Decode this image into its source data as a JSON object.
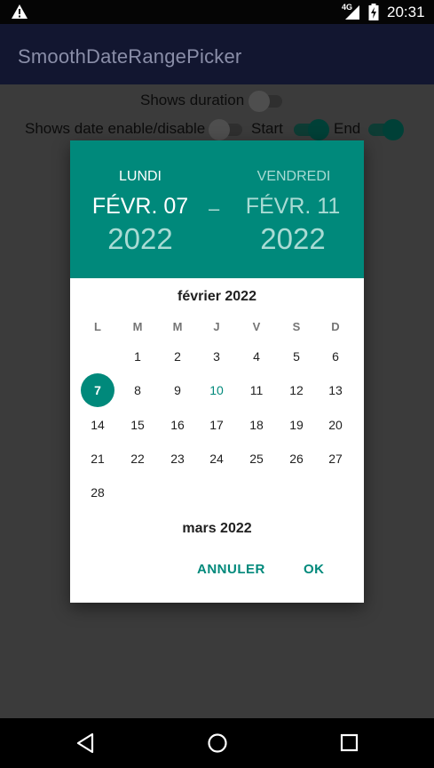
{
  "status_bar": {
    "network": "4G",
    "time": "20:31",
    "icons": [
      "warning-icon",
      "signal-icon",
      "battery-icon"
    ]
  },
  "app_bar": {
    "title": "SmoothDateRangePicker"
  },
  "settings": {
    "shows_duration_label": "Shows duration",
    "shows_duration_on": false,
    "shows_date_enable_label": "Shows date enable/disable",
    "shows_date_enable_on": false,
    "start_label": "Start",
    "start_on": true,
    "end_label": "End",
    "end_on": true
  },
  "dialog": {
    "start": {
      "weekday": "LUNDI",
      "date": "FÉVR. 07",
      "year": "2022"
    },
    "separator": "–",
    "end": {
      "weekday": "VENDREDI",
      "date": "FÉVR. 11",
      "year": "2022"
    },
    "month_title": "février 2022",
    "weekdays": [
      "L",
      "M",
      "M",
      "J",
      "V",
      "S",
      "D"
    ],
    "weeks": [
      [
        "",
        "1",
        "2",
        "3",
        "4",
        "5",
        "6"
      ],
      [
        "7",
        "8",
        "9",
        "10",
        "11",
        "12",
        "13"
      ],
      [
        "14",
        "15",
        "16",
        "17",
        "18",
        "19",
        "20"
      ],
      [
        "21",
        "22",
        "23",
        "24",
        "25",
        "26",
        "27"
      ],
      [
        "28",
        "",
        "",
        "",
        "",
        "",
        ""
      ]
    ],
    "selected_day": "7",
    "today_day": "10",
    "next_month_title": "mars 2022",
    "cancel_label": "ANNULER",
    "ok_label": "OK"
  },
  "colors": {
    "accent": "#00897b",
    "app_bar": "#121630",
    "scrim_background": "#3b3b3b"
  }
}
